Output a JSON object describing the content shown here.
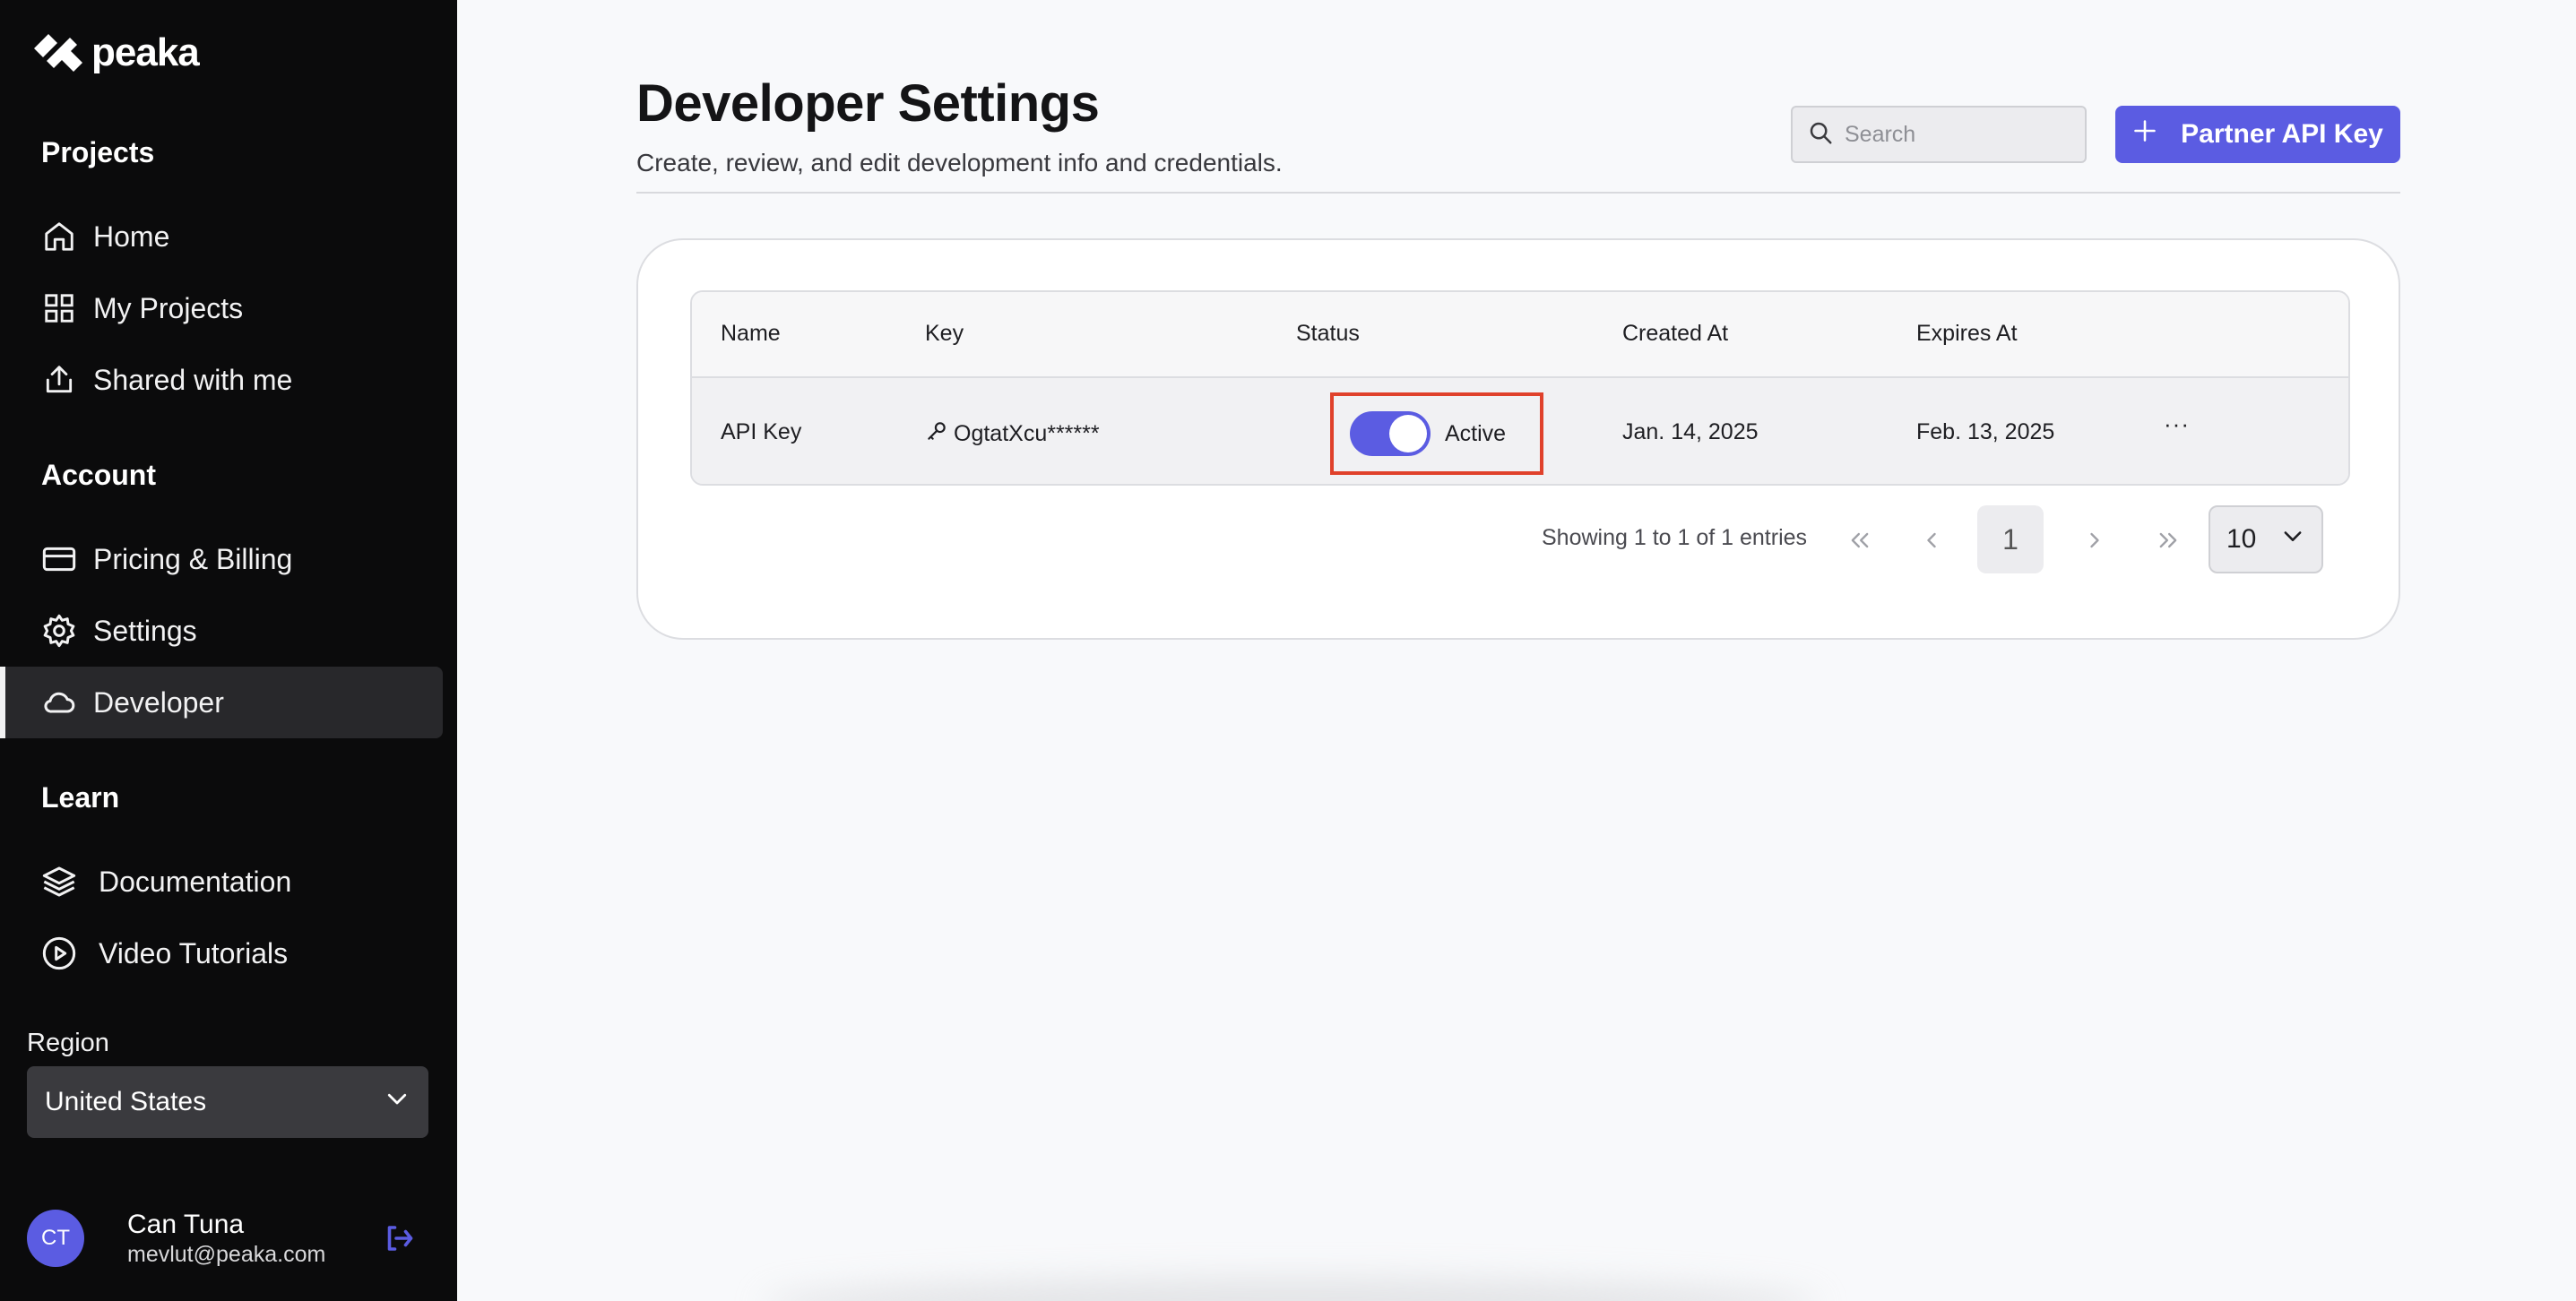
{
  "brand": {
    "name": "peaka"
  },
  "sidebar": {
    "sections": {
      "projects": "Projects",
      "account": "Account",
      "learn": "Learn"
    },
    "items": [
      {
        "label": "Home",
        "icon": "home-icon"
      },
      {
        "label": "My Projects",
        "icon": "grid-icon"
      },
      {
        "label": "Shared with me",
        "icon": "share-icon"
      },
      {
        "label": "Pricing & Billing",
        "icon": "credit-card-icon"
      },
      {
        "label": "Settings",
        "icon": "gear-icon"
      },
      {
        "label": "Developer",
        "icon": "cloud-icon",
        "active": true
      },
      {
        "label": "Documentation",
        "icon": "layers-icon"
      },
      {
        "label": "Video Tutorials",
        "icon": "play-circle-icon"
      }
    ],
    "region": {
      "label": "Region",
      "value": "United States"
    },
    "user": {
      "initials": "CT",
      "name": "Can Tuna",
      "email": "mevlut@peaka.com"
    }
  },
  "header": {
    "title": "Developer Settings",
    "subtitle": "Create, review, and edit development info and credentials.",
    "search_placeholder": "Search",
    "partner_button": "Partner API Key"
  },
  "table": {
    "columns": [
      "Name",
      "Key",
      "Status",
      "Created At",
      "Expires At"
    ],
    "rows": [
      {
        "name": "API Key",
        "key": "OgtatXcu******",
        "status": "Active",
        "status_on": true,
        "created_at": "Jan. 14, 2025",
        "expires_at": "Feb. 13, 2025",
        "actions": "···"
      }
    ]
  },
  "pagination": {
    "summary": "Showing 1 to 1 of 1 entries",
    "current_page": "1",
    "per_page": "10"
  },
  "colors": {
    "accent": "#5b5ce2",
    "sidebar_bg": "#0b0b0c",
    "highlight": "#e0412b"
  }
}
